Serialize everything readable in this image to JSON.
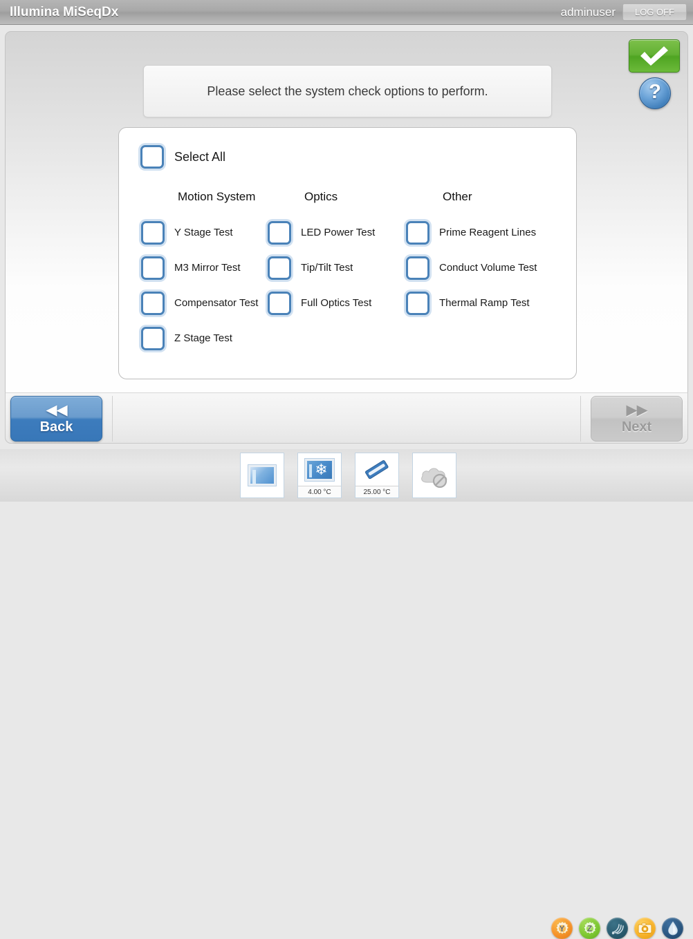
{
  "titlebar": {
    "app_title": "Illumina MiSeqDx",
    "username": "adminuser",
    "logoff_label": "LOG OFF"
  },
  "actions": {
    "confirm_icon": "green-checkmark",
    "help_label": "?"
  },
  "instruction": {
    "text": "Please select the system check options to perform."
  },
  "options": {
    "select_all_label": "Select All",
    "select_all_checked": false,
    "columns": [
      {
        "header": "Motion System",
        "items": [
          {
            "label": "Y Stage Test",
            "checked": false
          },
          {
            "label": "M3 Mirror Test",
            "checked": false
          },
          {
            "label": "Compensator Test",
            "checked": false
          },
          {
            "label": "Z Stage Test",
            "checked": false
          }
        ]
      },
      {
        "header": "Optics",
        "items": [
          {
            "label": "LED Power Test",
            "checked": false
          },
          {
            "label": "Tip/Tilt Test",
            "checked": false
          },
          {
            "label": "Full Optics Test",
            "checked": false
          }
        ]
      },
      {
        "header": "Other",
        "items": [
          {
            "label": "Prime Reagent Lines",
            "checked": false
          },
          {
            "label": "Conduct Volume Test",
            "checked": false
          },
          {
            "label": "Thermal Ramp Test",
            "checked": false
          }
        ]
      }
    ]
  },
  "nav": {
    "back_label": "Back",
    "back_arrows": "◀◀",
    "back_enabled": true,
    "next_label": "Next",
    "next_arrows": "▶▶",
    "next_enabled": false
  },
  "status_bar": {
    "tiles": [
      {
        "icon": "flow-cell-icon",
        "temp": ""
      },
      {
        "icon": "reagent-cooler-icon",
        "temp": "4.00 °C"
      },
      {
        "icon": "heater-icon",
        "temp": "25.00 °C"
      },
      {
        "icon": "cloud-disconnected-icon",
        "temp": ""
      }
    ],
    "sensors": [
      {
        "icon": "y-motor-gear-icon",
        "letter": "Y"
      },
      {
        "icon": "z-motor-gear-icon",
        "letter": "Z"
      },
      {
        "icon": "scanner-sensor-icon",
        "letter": ""
      },
      {
        "icon": "camera-sensor-icon",
        "letter": ""
      },
      {
        "icon": "fluidics-drop-icon",
        "letter": ""
      }
    ]
  },
  "colors": {
    "accent_blue": "#3d7cbd",
    "checkbox_border": "#4a82b8",
    "confirm_green": "#63b134",
    "titlebar_gray": "#a8a8a8"
  }
}
